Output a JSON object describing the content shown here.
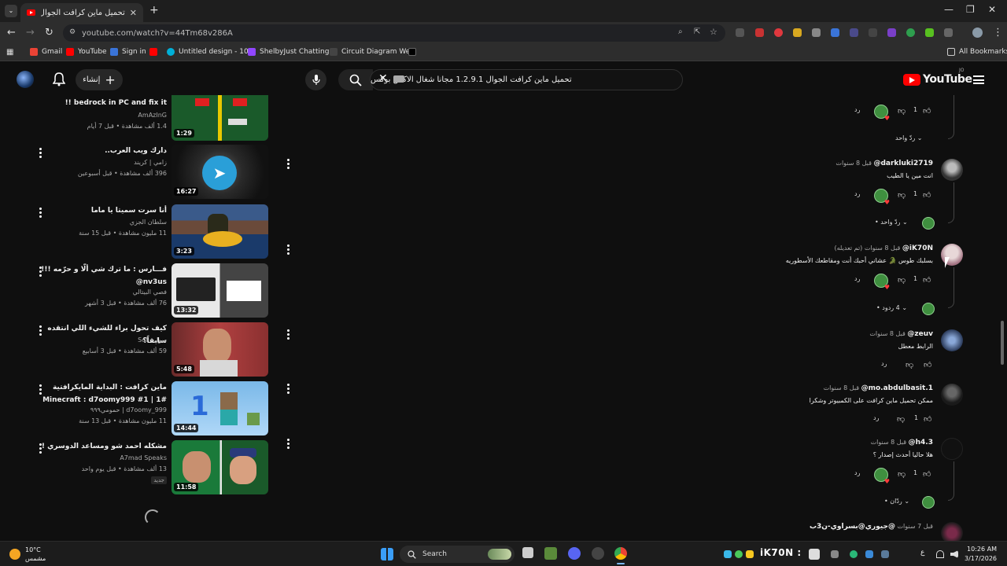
{
  "browser": {
    "tab_title": "تحميل ماين كرافت الجوال 1.2.9.1",
    "url": "youtube.com/watch?v=44Tm68v286A",
    "bookmarks": [
      "Gmail",
      "YouTube",
      "Sign in",
      "Untitled design - 10...",
      "ShelbyJust Chatting...",
      "Circuit Diagram We..."
    ],
    "all_bookmarks": "All Bookmarks"
  },
  "yt": {
    "logo": "YouTube",
    "country_code": "JO",
    "search_query": "تحميل ماين كرافت الجوال 1.2.9.1 مجانا شغال الاكس بوكس",
    "create_label": "إنشاء"
  },
  "recommendations": [
    {
      "title": "bedrock in PC and fix it !!",
      "channel": "AmAzInG",
      "meta": "1.4 ألف مشاهدة • قبل 7 أيام",
      "duration": "1:29"
    },
    {
      "title": "دارك ويب العرب..",
      "channel": "زامي | كريند",
      "meta": "396 ألف مشاهدة • قبل أسبوعين",
      "duration": "16:27"
    },
    {
      "title": "أنا سرت سميتا يا ماما",
      "channel": "سلطان الجزي",
      "meta": "11 مليون مشاهدة • قبل 15 سنة",
      "duration": "3:23"
    },
    {
      "title": "فـــارس : ما ترك شي ألّا و حرّمه !!! nv3us@",
      "channel": "فصي البيتالي",
      "meta": "76 ألف مشاهدة • قبل 3 أشهر",
      "duration": "13:32"
    },
    {
      "title": "كيف تحول براء للشيء اللي انتقده سابقاً؟",
      "channel": "سول - Sol",
      "meta": "59 ألف مشاهدة • قبل 3 أسابيع",
      "duration": "5:48"
    },
    {
      "title": "ماين كرافت : البداية المايكرافتية #1 | 1# Minecraft : d7oomy999",
      "channel": "d7oomy_999 | حمومي٩٩٩",
      "meta": "11 مليون مشاهدة • قبل 13 سنة",
      "duration": "14:44"
    },
    {
      "title": "مشكله احمد شو ومساعد الدوسري !",
      "channel": "A7mad Speaks",
      "meta": "13 ألف مشاهدة • قبل يوم واحد",
      "duration": "11:58",
      "badge": "جديد"
    }
  ],
  "comments": [
    {
      "author": "@darkluki2719",
      "time": "قبل 8 سنوات",
      "text": "انت مين يا الطيب",
      "likes": "1",
      "reply": "رد",
      "replies_label": "ردّ واحد"
    },
    {
      "author": "@iK70N",
      "time": "قبل 8 سنوات (تم تعديله)",
      "text": "بسلبك طوس 🐊 عشاني أحبك أنت ومقاطعك الأسطوريه",
      "likes": "1",
      "reply": "رد",
      "replies_label": "4 ردود"
    },
    {
      "author": "@zeuv",
      "time": "قبل 8 سنوات",
      "text": "الرابط معطل",
      "reply": "رد"
    },
    {
      "author": "@mo.abdulbasit.1",
      "time": "قبل 8 سنوات",
      "text": "ممكن تحميل ماين كرافت على الكمبيوتر وشكرا",
      "likes": "1",
      "reply": "رد"
    },
    {
      "author": "@h4.3",
      "time": "قبل 8 سنوات",
      "text": "هلا حاليا أحدث إصدار ؟",
      "likes": "1",
      "reply": "رد",
      "replies_label": "ردّان"
    },
    {
      "author": "@جيوري@بسراوي-ن3ب",
      "time": "قبل 7 سنوات"
    }
  ],
  "top_reply": {
    "likes": "1",
    "reply": "رد",
    "replies_label": "ردّ واحد"
  },
  "taskbar": {
    "weather_temp": "10°C",
    "weather_desc": "مشمس",
    "search": "Search",
    "tray_text": "iK70N :",
    "time": "10:26 AM",
    "date": "3/17/2026",
    "lang": "ع"
  },
  "colors": {
    "yt_red": "#ff0000",
    "background": "#0f0f0f",
    "accent_green": "#3f8f3f"
  }
}
